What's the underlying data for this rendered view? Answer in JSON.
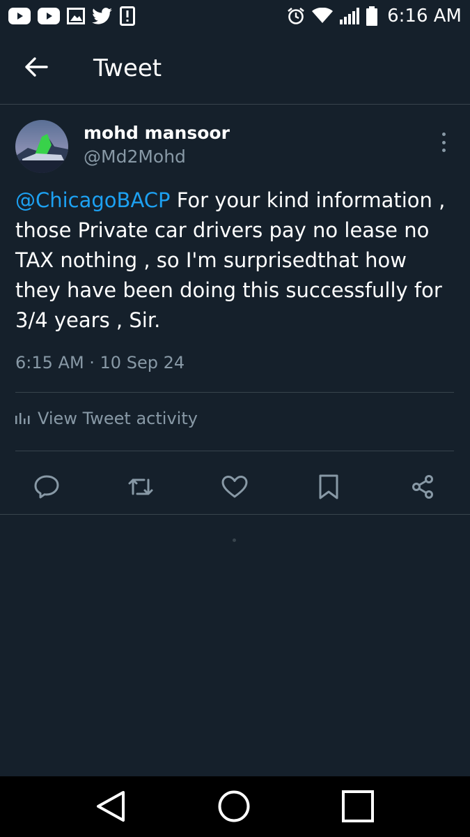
{
  "status_bar": {
    "time": "6:16 AM",
    "left_icons": [
      "youtube-icon",
      "youtube-icon",
      "gallery-icon",
      "twitter-icon",
      "alert-icon"
    ],
    "right_icons": [
      "alarm-icon",
      "wifi-icon",
      "signal-icon",
      "battery-icon"
    ]
  },
  "header": {
    "title": "Tweet",
    "back_icon": "back-arrow-icon"
  },
  "tweet": {
    "author_name": "mohd mansoor",
    "author_handle": "@Md2Mohd",
    "mention": "@ChicagoBACP",
    "text": " For your kind information , those Private car drivers pay no lease no TAX nothing , so I'm surprisedthat how they have been doing this successfully for 3/4 years , Sir.",
    "timestamp": "6:15 AM · 10 Sep 24",
    "activity_label": "View Tweet activity"
  },
  "actions": [
    "reply-icon",
    "retweet-icon",
    "like-icon",
    "bookmark-icon",
    "share-icon"
  ],
  "colors": {
    "background": "#15202b",
    "accent": "#1da1f2",
    "secondary_text": "#8899a6",
    "divider": "#38444d"
  }
}
